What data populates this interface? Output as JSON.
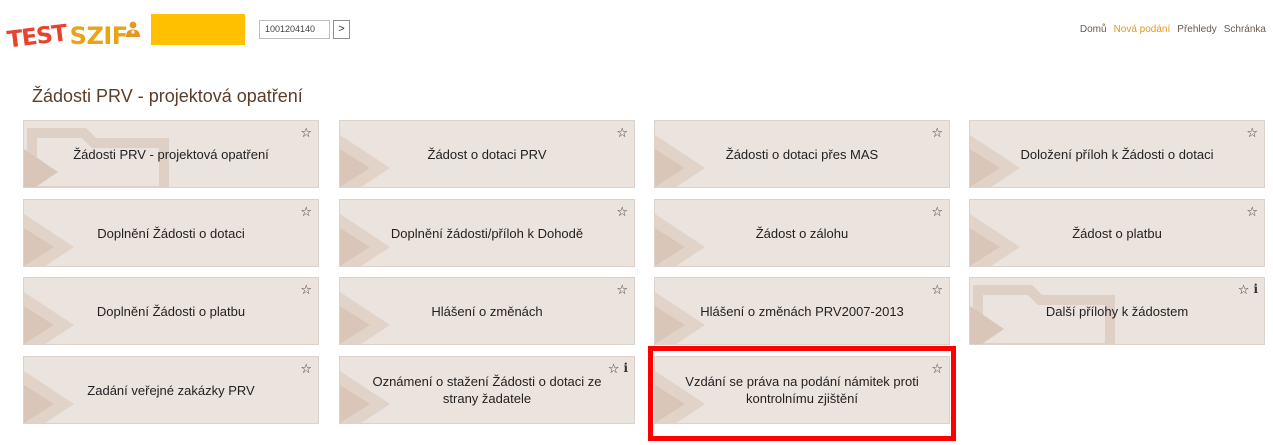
{
  "header": {
    "logo_prefix": "TEST",
    "logo_brand": "SZIF",
    "user_name": "",
    "client_id": "1001204140",
    "go_button": ">",
    "nav": [
      {
        "label": "Domů",
        "active": false
      },
      {
        "label": "Nová podání",
        "active": true
      },
      {
        "label": "Přehledy",
        "active": false
      },
      {
        "label": "Schránka",
        "active": false
      }
    ]
  },
  "page_title": "Žádosti PRV - projektová opatření",
  "tiles": [
    {
      "label": "Žádosti PRV - projektová opatření",
      "bg": "folder",
      "info": false
    },
    {
      "label": "Žádost o dotaci PRV",
      "bg": "chevron",
      "info": false
    },
    {
      "label": "Žádosti o dotaci přes MAS",
      "bg": "chevron",
      "info": false
    },
    {
      "label": "Doložení příloh k Žádosti o dotaci",
      "bg": "chevron",
      "info": false
    },
    {
      "label": "Doplnění Žádosti o dotaci",
      "bg": "chevron",
      "info": false
    },
    {
      "label": "Doplnění žádosti/příloh k Dohodě",
      "bg": "chevron",
      "info": false
    },
    {
      "label": "Žádost o zálohu",
      "bg": "chevron",
      "info": false
    },
    {
      "label": "Žádost o platbu",
      "bg": "chevron",
      "info": false
    },
    {
      "label": "Doplnění Žádosti o platbu",
      "bg": "chevron",
      "info": false
    },
    {
      "label": "Hlášení o změnách",
      "bg": "chevron",
      "info": false
    },
    {
      "label": "Hlášení o změnách PRV2007-2013",
      "bg": "chevron",
      "info": false
    },
    {
      "label": "Další přílohy k žádostem",
      "bg": "folder",
      "info": true
    },
    {
      "label": "Zadání veřejné zakázky PRV",
      "bg": "chevron",
      "info": false
    },
    {
      "label": "Oznámení o stažení Žádosti o dotaci ze strany žadatele",
      "bg": "chevron",
      "info": true
    },
    {
      "label": "Vzdání se práva na podání námitek proti kontrolnímu zjištění",
      "bg": "chevron",
      "info": false,
      "highlighted": true
    }
  ],
  "icons": {
    "favorite": "star-outline-icon",
    "info": "info-icon",
    "user": "user-icon"
  },
  "colors": {
    "accent_orange": "#e8961f",
    "logo_red": "#e8432d",
    "logo_orange": "#e8a317",
    "tile_bg": "#ebe3de",
    "highlight_red": "#ff0000",
    "user_box": "#ffc000"
  }
}
